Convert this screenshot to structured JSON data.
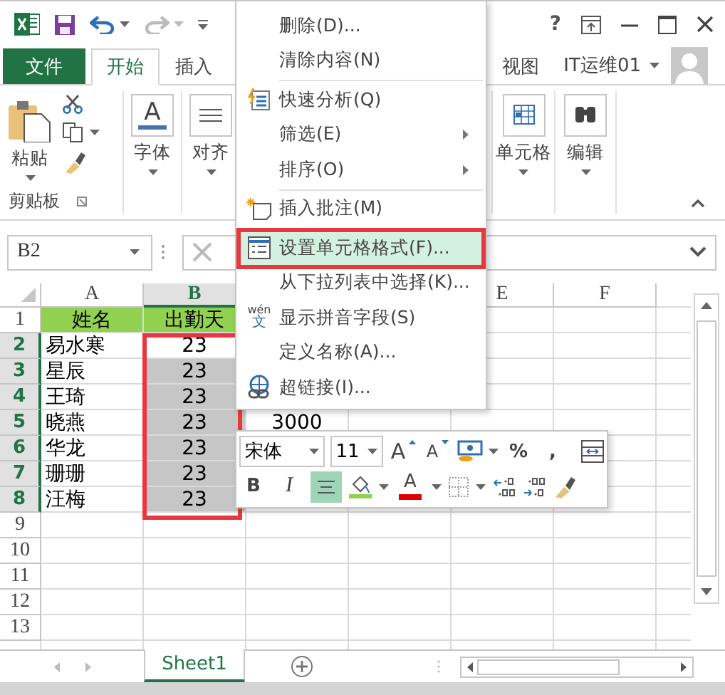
{
  "title_bar": {
    "help": "?"
  },
  "ribbon_tabs": [
    {
      "label": "文件",
      "kind": "file"
    },
    {
      "label": "开始",
      "kind": "tab",
      "selected": true
    },
    {
      "label": "插入",
      "kind": "tab",
      "selected": false
    },
    {
      "label": "视图",
      "kind": "tab",
      "selected": false
    }
  ],
  "account": {
    "name": "IT运维01"
  },
  "ribbon": {
    "paste": "粘贴",
    "clipboard_label": "剪贴板",
    "font": {
      "glyph": "A",
      "label": "字体"
    },
    "alignment": {
      "label": "对齐"
    },
    "cells": {
      "label": "单元格"
    },
    "editing": {
      "label": "编辑"
    }
  },
  "formula_bar": {
    "name_box": "B2"
  },
  "sheet": {
    "outline_frame": true,
    "columns": [
      {
        "label": "A",
        "selected": false
      },
      {
        "label": "B",
        "selected": true
      },
      null,
      null,
      {
        "label": "E",
        "selected": false
      },
      {
        "label": "F",
        "selected": false
      }
    ],
    "rows": [
      {
        "header": "1",
        "selected": false,
        "cells": [
          {
            "text": "姓名",
            "kind": "title"
          },
          {
            "text": "出勤天",
            "kind": "title"
          }
        ]
      },
      {
        "header": "2",
        "selected": true,
        "cells": [
          {
            "text": "易水寒",
            "kind": "name"
          },
          {
            "text": "23",
            "kind": "number",
            "selected": false
          }
        ]
      },
      {
        "header": "3",
        "selected": true,
        "cells": [
          {
            "text": "星辰",
            "kind": "name"
          },
          {
            "text": "23",
            "kind": "number",
            "selected": true
          }
        ]
      },
      {
        "header": "4",
        "selected": true,
        "cells": [
          {
            "text": "王琦",
            "kind": "name"
          },
          {
            "text": "23",
            "kind": "number",
            "selected": true
          }
        ]
      },
      {
        "header": "5",
        "selected": true,
        "cells": [
          {
            "text": "晓燕",
            "kind": "name"
          },
          {
            "text": "23",
            "kind": "number",
            "selected": true
          },
          {
            "text": "3000",
            "kind": "number"
          }
        ]
      },
      {
        "header": "6",
        "selected": true,
        "cells": [
          {
            "text": "华龙",
            "kind": "name"
          },
          {
            "text": "23",
            "kind": "number",
            "selected": true
          }
        ]
      },
      {
        "header": "7",
        "selected": true,
        "cells": [
          {
            "text": "珊珊",
            "kind": "name"
          },
          {
            "text": "23",
            "kind": "number",
            "selected": true
          }
        ]
      },
      {
        "header": "8",
        "selected": true,
        "cells": [
          {
            "text": "汪梅",
            "kind": "name"
          },
          {
            "text": "23",
            "kind": "number",
            "selected": true
          }
        ]
      },
      {
        "header": "9",
        "selected": false
      },
      {
        "header": "10",
        "selected": false
      },
      {
        "header": "11",
        "selected": false
      },
      {
        "header": "12",
        "selected": false
      },
      {
        "header": "13",
        "selected": false
      }
    ]
  },
  "sheets": [
    {
      "label": "Sheet1",
      "selected": true
    }
  ],
  "context_menu": {
    "items": [
      {
        "kind": "item",
        "label": "删除(D)...",
        "selected": false,
        "outlined": false
      },
      {
        "kind": "item",
        "label": "清除内容(N)",
        "selected": false,
        "outlined": false
      },
      {
        "kind": "separator"
      },
      {
        "kind": "item",
        "label": "快速分析(Q)",
        "selected": false,
        "outlined": false
      },
      {
        "kind": "submenu",
        "label": "筛选(E)",
        "selected": false,
        "outlined": false
      },
      {
        "kind": "submenu",
        "label": "排序(O)",
        "selected": false,
        "outlined": false
      },
      {
        "kind": "separator"
      },
      {
        "kind": "item",
        "label": "插入批注(M)",
        "selected": false,
        "outlined": false
      },
      {
        "kind": "separator"
      },
      {
        "kind": "item",
        "label": "设置单元格格式(F)...",
        "selected": true,
        "outlined": true
      },
      {
        "kind": "item",
        "label": "从下拉列表中选择(K)...",
        "selected": false,
        "outlined": false
      },
      {
        "kind": "item",
        "label": "显示拼音字段(S)",
        "selected": false,
        "outlined": false,
        "icon_text": [
          "wén",
          "文"
        ]
      },
      {
        "kind": "item",
        "label": "定义名称(A)...",
        "selected": false,
        "outlined": false
      },
      {
        "kind": "item",
        "label": "超链接(I)...",
        "selected": false,
        "outlined": false
      }
    ]
  },
  "mini_toolbar": {
    "font": "宋体",
    "size": "11",
    "grow": "A",
    "shrink": "A",
    "percent": "%",
    "comma": ",",
    "bold": "B",
    "italic": "I",
    "font_color": "A",
    "align_center": {
      "on": true
    }
  }
}
